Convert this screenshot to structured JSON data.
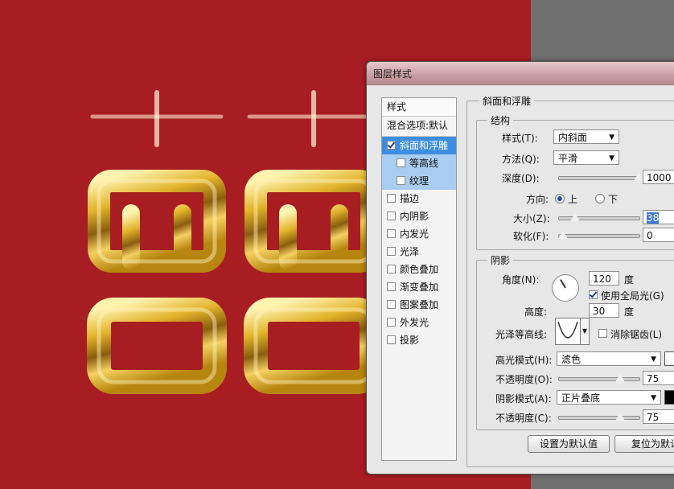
{
  "canvas": {
    "artwork": "喜喜",
    "background_color": "#a81d22"
  },
  "dialog": {
    "title": "图层样式",
    "left_list": {
      "header": "样式",
      "blend_options": "混合选项:默认",
      "items": [
        {
          "label": "斜面和浮雕",
          "checked": true,
          "selected": true
        },
        {
          "label": "等高线",
          "checked": false,
          "sub": true
        },
        {
          "label": "纹理",
          "checked": false,
          "sub": true
        },
        {
          "label": "描边",
          "checked": false
        },
        {
          "label": "内阴影",
          "checked": false
        },
        {
          "label": "内发光",
          "checked": false
        },
        {
          "label": "光泽",
          "checked": false
        },
        {
          "label": "颜色叠加",
          "checked": false
        },
        {
          "label": "渐变叠加",
          "checked": false
        },
        {
          "label": "图案叠加",
          "checked": false
        },
        {
          "label": "外发光",
          "checked": false
        },
        {
          "label": "投影",
          "checked": false
        }
      ]
    },
    "bevel": {
      "section_title": "斜面和浮雕",
      "structure_title": "结构",
      "style_label": "样式(T):",
      "style_value": "内斜面",
      "technique_label": "方法(Q):",
      "technique_value": "平滑",
      "depth_label": "深度(D):",
      "depth_value": "1000",
      "depth_level": 1.0,
      "direction_label": "方向:",
      "direction_up": "上",
      "direction_down": "下",
      "size_label": "大小(Z):",
      "size_value": "38",
      "size_level": 0.16,
      "soften_label": "软化(F):",
      "soften_value": "0",
      "soften_level": 0.0
    },
    "shading": {
      "title": "阴影",
      "angle_label": "角度(N):",
      "angle_value": "120",
      "degree_unit": "度",
      "global_light_label": "使用全局光(G)",
      "global_light_checked": true,
      "altitude_label": "高度:",
      "altitude_value": "30",
      "gloss_contour_label": "光泽等高线:",
      "anti_aliased_label": "消除锯齿(L)",
      "anti_aliased_checked": false,
      "highlight_mode_label": "高光模式(H):",
      "highlight_mode_value": "滤色",
      "highlight_color": "#ffffff",
      "opacity1_label": "不透明度(O):",
      "opacity1_value": "75",
      "opacity1_level": 0.75,
      "shadow_mode_label": "阴影模式(A):",
      "shadow_mode_value": "正片叠底",
      "shadow_color": "#000000",
      "opacity2_label": "不透明度(C):",
      "opacity2_value": "75",
      "opacity2_level": 0.75
    },
    "buttons": {
      "make_default": "设置为默认值",
      "reset_default": "复位为默认"
    }
  }
}
